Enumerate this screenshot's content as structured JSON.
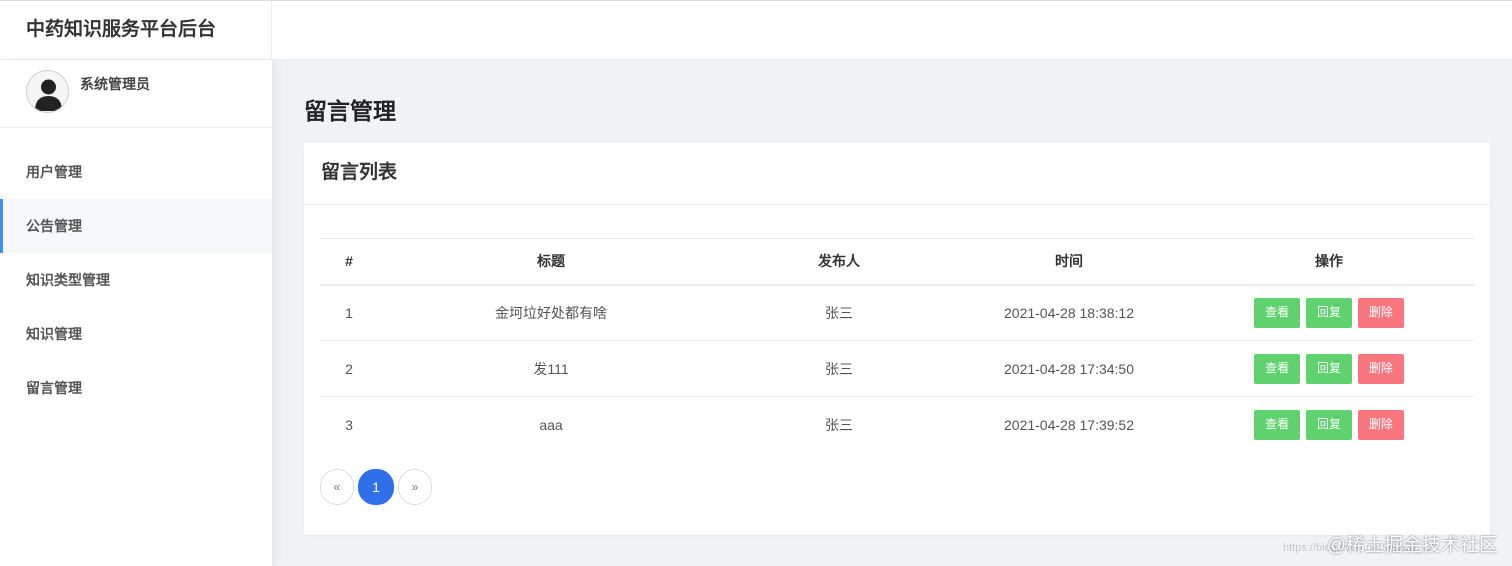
{
  "app": {
    "title": "中药知识服务平台后台"
  },
  "user": {
    "name": "系统管理员",
    "avatar_icon": "user-avatar-icon"
  },
  "sidebar": {
    "items": [
      {
        "label": "用户管理",
        "active": false
      },
      {
        "label": "公告管理",
        "active": true
      },
      {
        "label": "知识类型管理",
        "active": false
      },
      {
        "label": "知识管理",
        "active": false
      },
      {
        "label": "留言管理",
        "active": false
      }
    ]
  },
  "page": {
    "title": "留言管理"
  },
  "card": {
    "title": "留言列表"
  },
  "table": {
    "headers": [
      "#",
      "标题",
      "发布人",
      "时间",
      "操作"
    ],
    "rows": [
      {
        "id": "1",
        "title": "金坷垃好处都有啥",
        "author": "张三",
        "time": "2021-04-28 18:38:12"
      },
      {
        "id": "2",
        "title": "发111",
        "author": "张三",
        "time": "2021-04-28 17:34:50"
      },
      {
        "id": "3",
        "title": "aaa",
        "author": "张三",
        "time": "2021-04-28 17:39:52"
      }
    ],
    "actions": {
      "view": "查看",
      "reply": "回复",
      "delete": "删除"
    }
  },
  "pagination": {
    "prev": "«",
    "current": "1",
    "next": "»"
  },
  "watermark": {
    "text": "@稀土掘金技术社区",
    "url": "https://blog.csdn.net/weixin_42"
  },
  "colors": {
    "accent": "#3b8ff5",
    "page_active": "#2f6fe8",
    "success": "#5fd16f",
    "danger": "#f7767f"
  }
}
